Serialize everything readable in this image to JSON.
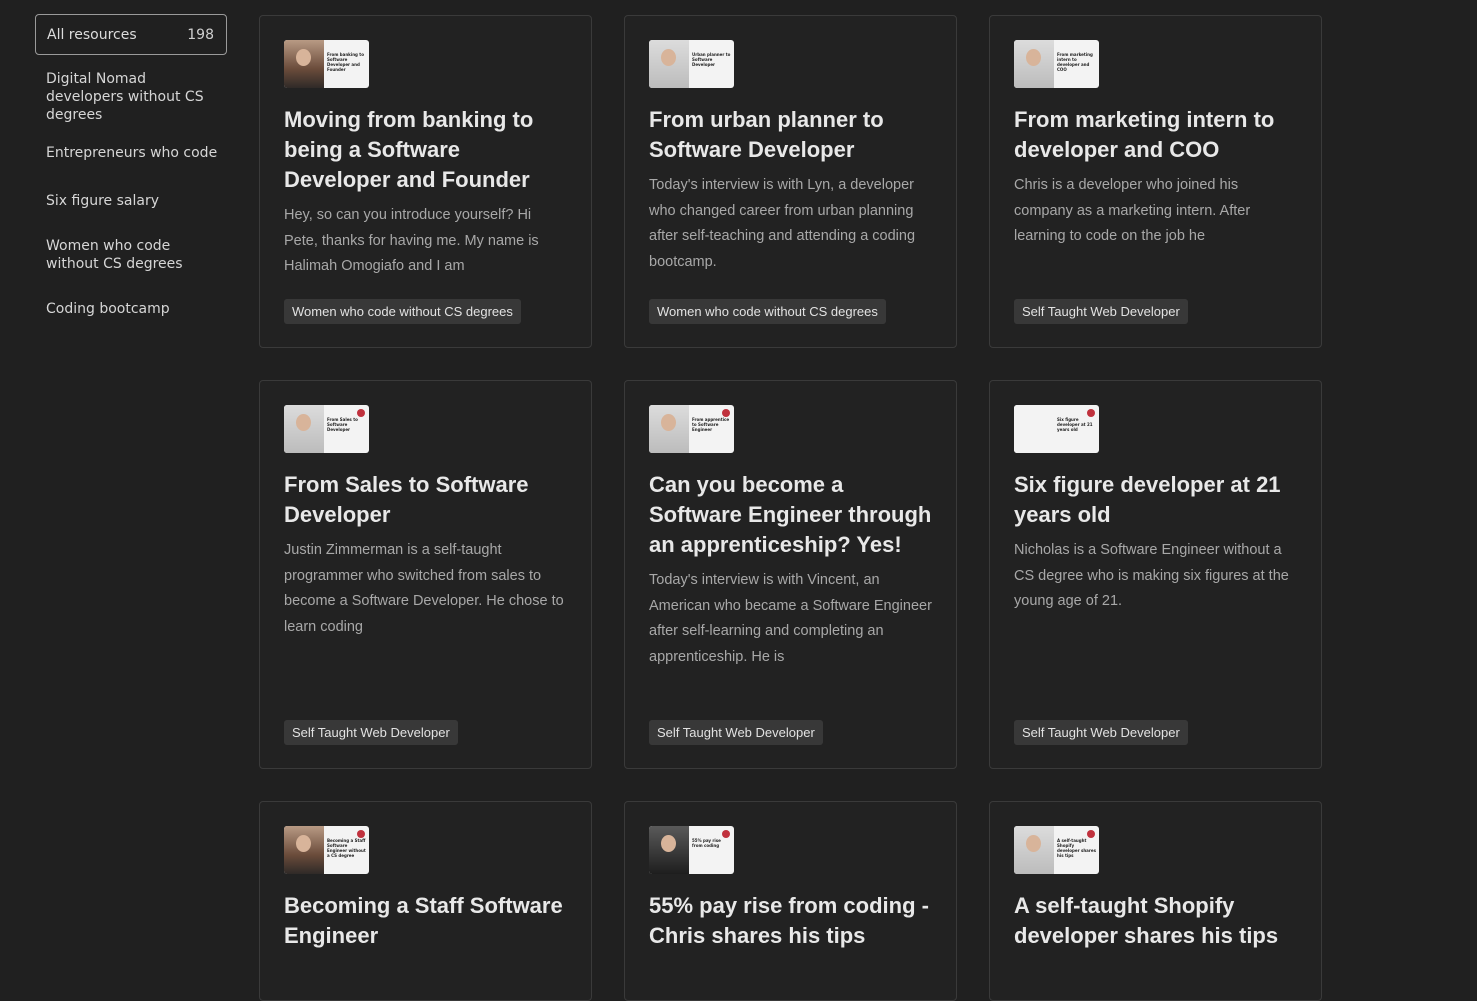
{
  "sidebar": {
    "all": {
      "label": "All resources",
      "count": "198"
    },
    "items": [
      {
        "label": "Digital Nomad developers without CS degrees"
      },
      {
        "label": "Entrepreneurs who code"
      },
      {
        "label": "Six figure salary"
      },
      {
        "label": "Women who code without CS degrees"
      },
      {
        "label": "Coding bootcamp"
      }
    ]
  },
  "cards": [
    {
      "thumb_text": "From banking to Software Developer and Founder",
      "title": "Moving from banking to being a Software Developer and Founder",
      "excerpt": "Hey, so can you introduce yourself? Hi Pete, thanks for having me. My name is Halimah Omogiafo and I am",
      "tag": "Women who code without CS degrees"
    },
    {
      "thumb_text": "Urban planner to Software Developer",
      "title": "From urban planner to Software Developer",
      "excerpt": "Today's interview is with Lyn, a developer who changed career from urban planning after self-teaching and attending a coding bootcamp.",
      "tag": "Women who code without CS degrees"
    },
    {
      "thumb_text": "From marketing intern to developer and COO",
      "title": "From marketing intern to developer and COO",
      "excerpt": "Chris is a developer who joined his company as a marketing intern. After learning to code on the job he",
      "tag": "Self Taught Web Developer"
    },
    {
      "thumb_text": "From Sales to Software Developer",
      "title": "From Sales to Software Developer",
      "excerpt": "Justin Zimmerman is a self-taught programmer who switched from sales to become a Software Developer. He chose to learn coding",
      "tag": "Self Taught Web Developer"
    },
    {
      "thumb_text": "From apprentice to Software Engineer",
      "title": "Can you become a Software Engineer through an apprenticeship? Yes!",
      "excerpt": "Today's interview is with Vincent, an American who became a Software Engineer after self-learning and completing an apprenticeship. He is",
      "tag": "Self Taught Web Developer"
    },
    {
      "thumb_text": "Six figure developer at 21 years old",
      "title": "Six figure developer at 21 years old",
      "excerpt": "Nicholas is a Software Engineer without a CS degree who is making six figures at the young age of 21.",
      "tag": "Self Taught Web Developer"
    },
    {
      "thumb_text": "Becoming a Staff Software Engineer without a CS degree",
      "title": "Becoming a Staff Software Engineer",
      "excerpt": "",
      "tag": ""
    },
    {
      "thumb_text": "55% pay rise from coding",
      "title": "55% pay rise from coding - Chris shares his tips",
      "excerpt": "",
      "tag": ""
    },
    {
      "thumb_text": "A self-taught Shopify developer shares his tips",
      "title": "A self-taught Shopify developer shares his tips",
      "excerpt": "",
      "tag": ""
    }
  ]
}
